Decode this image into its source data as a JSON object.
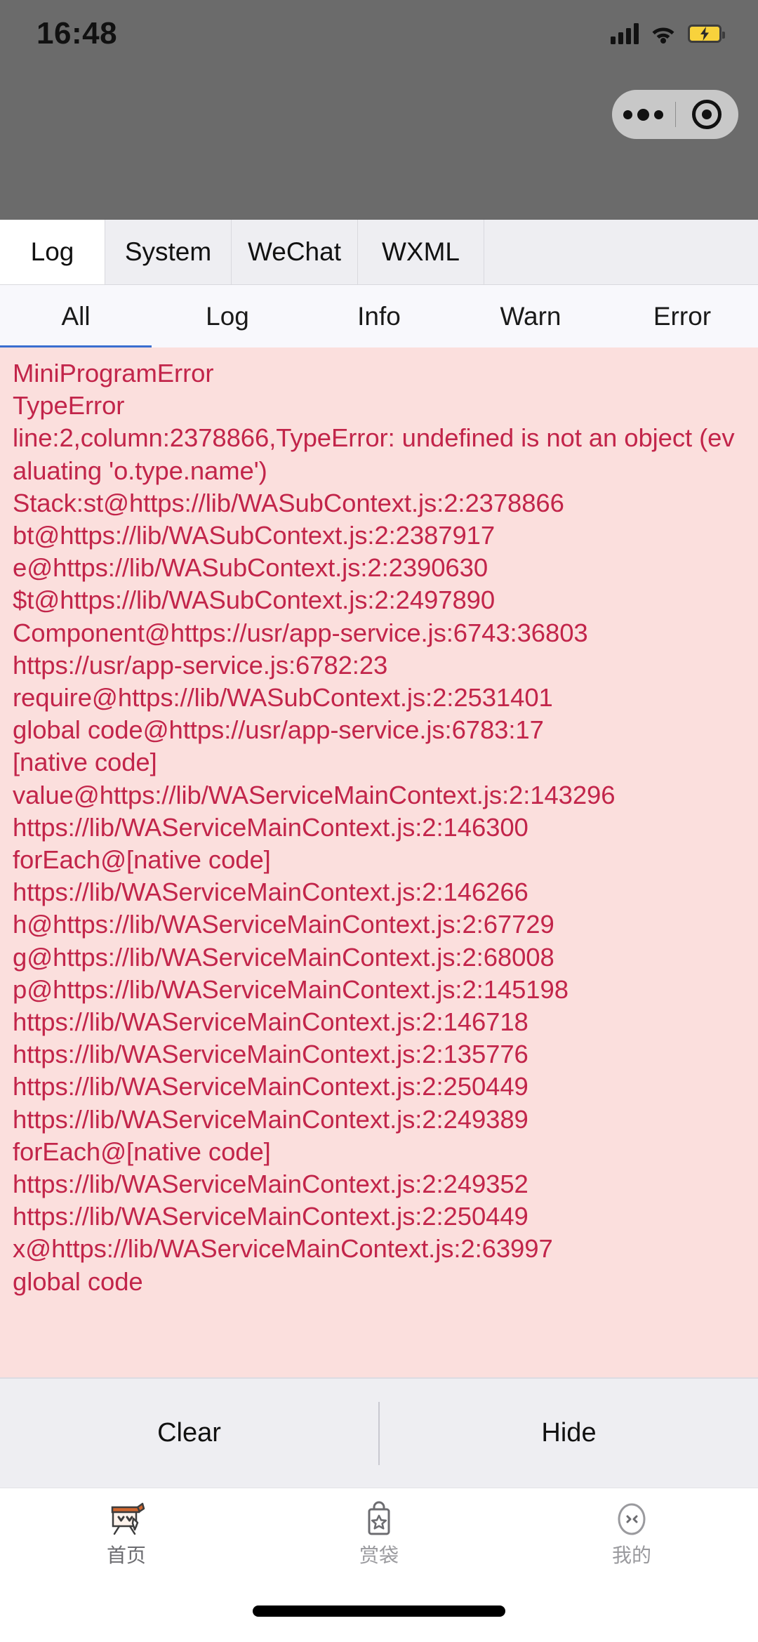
{
  "status_bar": {
    "time": "16:48",
    "icons": [
      "signal-bars-icon",
      "wifi-icon",
      "battery-charging-icon"
    ]
  },
  "nav_capsule": {
    "menu_icon": "more-dots-icon",
    "close_icon": "target-circle-icon"
  },
  "console": {
    "tabs": [
      {
        "label": "Log",
        "active": true
      },
      {
        "label": "System",
        "active": false
      },
      {
        "label": "WeChat",
        "active": false
      },
      {
        "label": "WXML",
        "active": false
      }
    ],
    "filters": [
      {
        "label": "All",
        "active": true
      },
      {
        "label": "Log",
        "active": false
      },
      {
        "label": "Info",
        "active": false
      },
      {
        "label": "Warn",
        "active": false
      },
      {
        "label": "Error",
        "active": false
      }
    ],
    "log_entry": {
      "level": "error",
      "text_color": "#c2254a",
      "background_color": "#fbdfdd",
      "lines": [
        "MiniProgramError",
        "TypeError",
        "line:2,column:2378866,TypeError: undefined is not an object (evaluating 'o.type.name')",
        "Stack:st@https://lib/WASubContext.js:2:2378866",
        "bt@https://lib/WASubContext.js:2:2387917",
        "e@https://lib/WASubContext.js:2:2390630",
        "$t@https://lib/WASubContext.js:2:2497890",
        "Component@https://usr/app-service.js:6743:36803",
        "https://usr/app-service.js:6782:23",
        "require@https://lib/WASubContext.js:2:2531401",
        "global code@https://usr/app-service.js:6783:17",
        "[native code]",
        "value@https://lib/WAServiceMainContext.js:2:143296",
        "https://lib/WAServiceMainContext.js:2:146300",
        "forEach@[native code]",
        "https://lib/WAServiceMainContext.js:2:146266",
        "h@https://lib/WAServiceMainContext.js:2:67729",
        "g@https://lib/WAServiceMainContext.js:2:68008",
        "p@https://lib/WAServiceMainContext.js:2:145198",
        "https://lib/WAServiceMainContext.js:2:146718",
        "https://lib/WAServiceMainContext.js:2:135776",
        "https://lib/WAServiceMainContext.js:2:250449",
        "https://lib/WAServiceMainContext.js:2:249389",
        "forEach@[native code]",
        "https://lib/WAServiceMainContext.js:2:249352",
        "https://lib/WAServiceMainContext.js:2:250449",
        "x@https://lib/WAServiceMainContext.js:2:63997",
        "global code"
      ]
    },
    "actions": {
      "clear_label": "Clear",
      "hide_label": "Hide"
    }
  },
  "bottom_nav": {
    "items": [
      {
        "label": "首页",
        "icon": "easel-home-icon",
        "active": true
      },
      {
        "label": "赏袋",
        "icon": "bag-star-icon",
        "active": false
      },
      {
        "label": "我的",
        "icon": "profile-face-icon",
        "active": false
      }
    ]
  },
  "colors": {
    "accent_blue": "#3a6ed0",
    "error_text": "#c2254a",
    "error_bg": "#fbdfdd",
    "chrome_grey": "#6b6b6b",
    "panel_grey": "#eeeef2"
  }
}
